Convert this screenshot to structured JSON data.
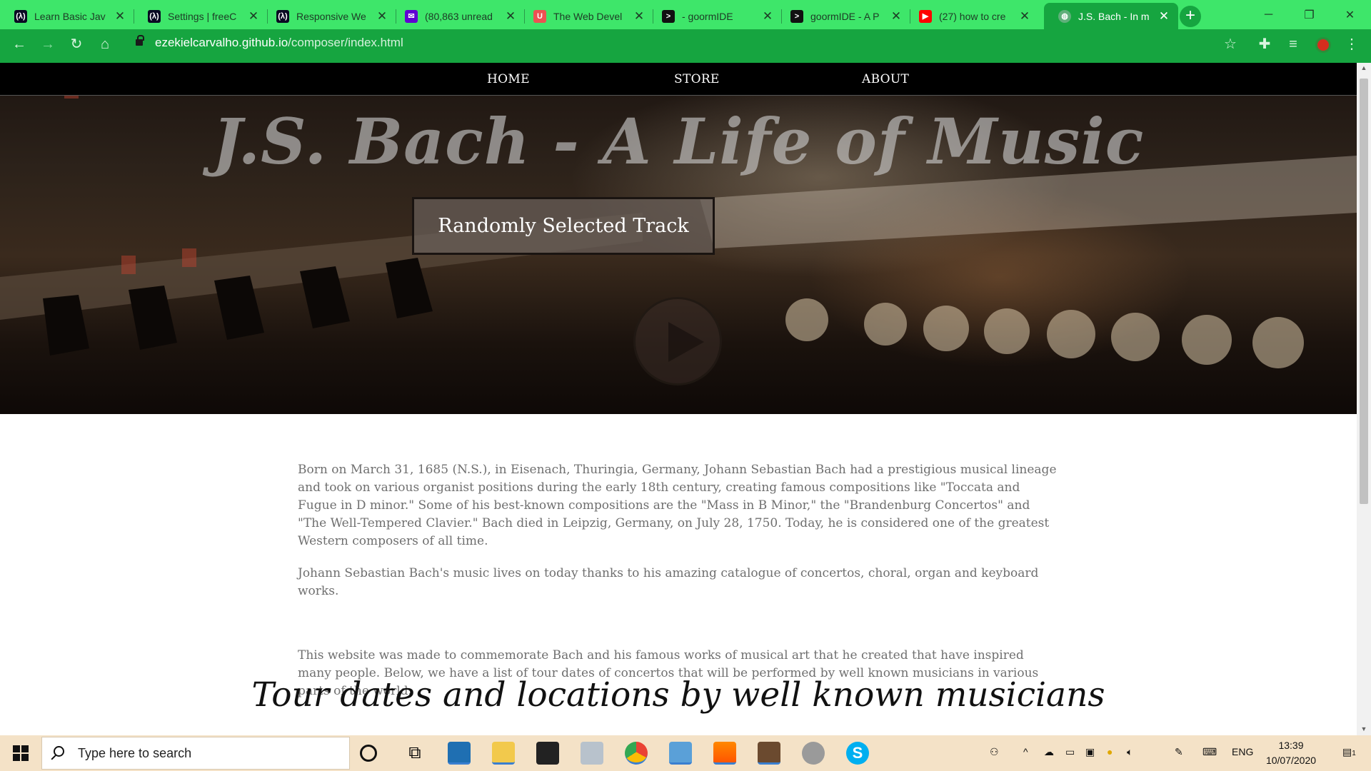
{
  "browser": {
    "tabs": [
      {
        "title": "Learn Basic Jav",
        "icon": "freecodecamp-icon",
        "active": false
      },
      {
        "title": "Settings | freeC",
        "icon": "freecodecamp-icon",
        "active": false
      },
      {
        "title": "Responsive We",
        "icon": "freecodecamp-icon",
        "active": false
      },
      {
        "title": "(80,863 unread",
        "icon": "yahoo-mail-icon",
        "active": false
      },
      {
        "title": "The Web Devel",
        "icon": "udemy-icon",
        "active": false
      },
      {
        "title": "- goormIDE",
        "icon": "terminal-icon",
        "active": false
      },
      {
        "title": "goormIDE - A P",
        "icon": "terminal-icon",
        "active": false
      },
      {
        "title": "(27) how to cre",
        "icon": "youtube-icon",
        "active": false
      },
      {
        "title": "J.S. Bach - In m",
        "icon": "globe-icon",
        "active": true
      }
    ],
    "url_host": "ezekielcarvalho.github.io",
    "url_path": "/composer/index.html",
    "accent": "#16a540",
    "tabbar_color": "#3ee66a"
  },
  "page": {
    "nav": {
      "home": "HOME",
      "store": "STORE",
      "about": "ABOUT"
    },
    "hero_title": "J.S. Bach - A Life of Music",
    "track_button": "Randomly Selected Track",
    "paragraph1": "Born on March 31, 1685 (N.S.), in Eisenach, Thuringia, Germany, Johann Sebastian Bach had a prestigious musical lineage and took on various organist positions during the early 18th century, creating famous compositions like \"Toccata and Fugue in D minor.\" Some of his best-known compositions are the \"Mass in B Minor,\" the \"Brandenburg Concertos\" and \"The Well-Tempered Clavier.\" Bach died in Leipzig, Germany, on July 28, 1750. Today, he is considered one of the greatest Western composers of all time.",
    "paragraph2": "Johann Sebastian Bach's music lives on today thanks to his amazing catalogue of concertos, choral, organ and keyboard works.",
    "paragraph3": "This website was made to commemorate Bach and his famous works of musical art that he created that have inspired many people. Below, we have a list of tour dates of concertos that will be performed by well known musicians in various parts of the world.",
    "tour_heading": "Tour dates and locations by well known musicians"
  },
  "taskbar": {
    "search_placeholder": "Type here to search",
    "language": "ENG",
    "time": "13:39",
    "date": "10/07/2020",
    "notification_count": "1"
  }
}
